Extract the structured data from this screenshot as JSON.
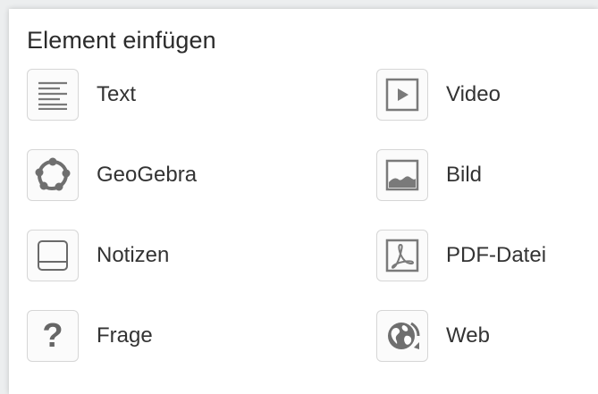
{
  "panel": {
    "title": "Element einfügen"
  },
  "items": [
    {
      "label": "Text",
      "icon": "text-lines-icon"
    },
    {
      "label": "Video",
      "icon": "video-play-icon"
    },
    {
      "label": "GeoGebra",
      "icon": "geogebra-icon"
    },
    {
      "label": "Bild",
      "icon": "image-icon"
    },
    {
      "label": "Notizen",
      "icon": "notes-icon"
    },
    {
      "label": "PDF-Datei",
      "icon": "pdf-icon"
    },
    {
      "label": "Frage",
      "icon": "question-icon",
      "glyph": "?"
    },
    {
      "label": "Web",
      "icon": "web-globe-icon"
    }
  ],
  "colors": {
    "icon_gray": "#6f6f6f",
    "border": "#d6d6d6",
    "text": "#333333"
  }
}
